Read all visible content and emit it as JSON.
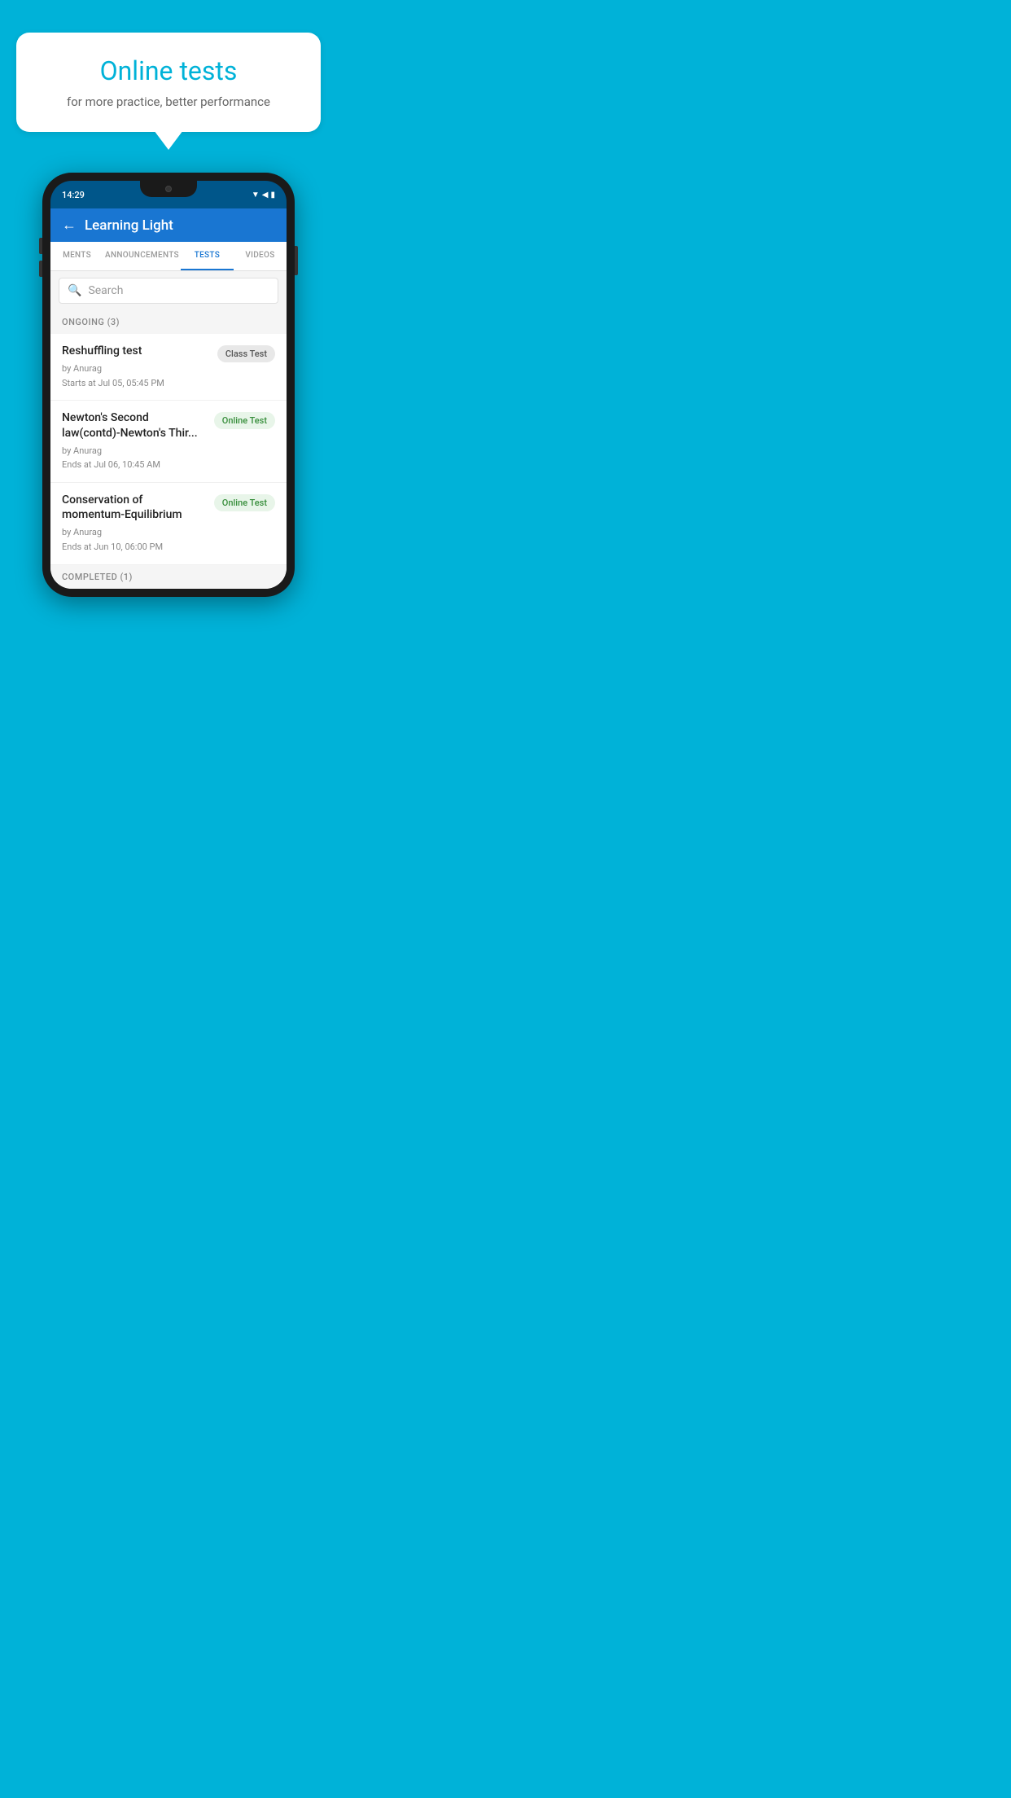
{
  "background_color": "#00B2D8",
  "speech_bubble": {
    "title": "Online tests",
    "subtitle": "for more practice, better performance"
  },
  "phone": {
    "status_bar": {
      "time": "14:29"
    },
    "app": {
      "title": "Learning Light",
      "back_label": "←"
    },
    "tabs": [
      {
        "label": "MENTS",
        "active": false
      },
      {
        "label": "ANNOUNCEMENTS",
        "active": false
      },
      {
        "label": "TESTS",
        "active": true
      },
      {
        "label": "VIDEOS",
        "active": false
      }
    ],
    "search": {
      "placeholder": "Search"
    },
    "ongoing_section": {
      "label": "ONGOING (3)"
    },
    "tests": [
      {
        "name": "Reshuffling test",
        "by": "by Anurag",
        "time_label": "Starts at  Jul 05, 05:45 PM",
        "badge": "Class Test",
        "badge_type": "class"
      },
      {
        "name": "Newton's Second law(contd)-Newton's Thir...",
        "by": "by Anurag",
        "time_label": "Ends at  Jul 06, 10:45 AM",
        "badge": "Online Test",
        "badge_type": "online"
      },
      {
        "name": "Conservation of momentum-Equilibrium",
        "by": "by Anurag",
        "time_label": "Ends at  Jun 10, 06:00 PM",
        "badge": "Online Test",
        "badge_type": "online"
      }
    ],
    "completed_section": {
      "label": "COMPLETED (1)"
    }
  }
}
